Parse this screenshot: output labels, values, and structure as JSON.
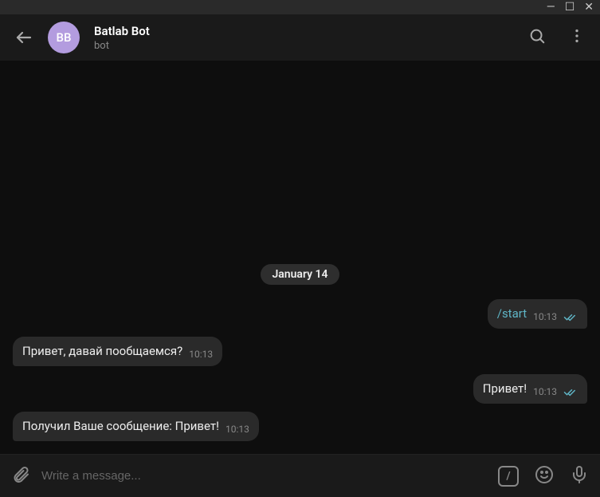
{
  "header": {
    "avatar_initials": "BB",
    "title": "Batlab Bot",
    "subtitle": "bot"
  },
  "chat": {
    "date_label": "January 14",
    "messages": [
      {
        "direction": "out",
        "text": "/start",
        "time": "10:13",
        "command": true,
        "read": true
      },
      {
        "direction": "in",
        "text": "Привет, давай пообщаемся?",
        "time": "10:13"
      },
      {
        "direction": "out",
        "text": "Привет!",
        "time": "10:13",
        "read": true
      },
      {
        "direction": "in",
        "text": "Получил Ваше сообщение: Привет!",
        "time": "10:13"
      }
    ]
  },
  "composer": {
    "placeholder": "Write a message..."
  }
}
